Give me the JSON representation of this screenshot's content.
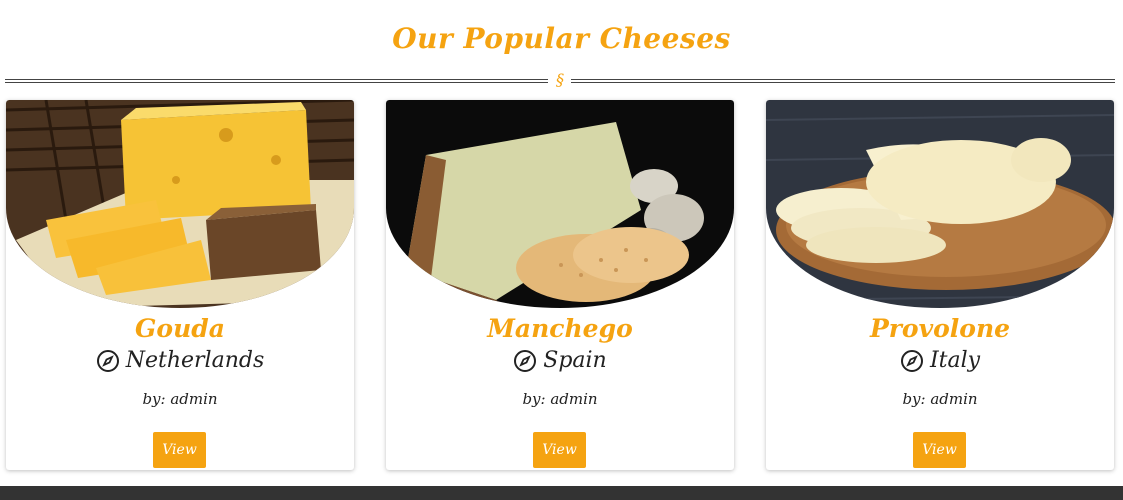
{
  "section": {
    "title": "Our Popular Cheeses",
    "divider_mark": "§"
  },
  "colors": {
    "accent": "#f5a311",
    "text": "#222222",
    "footer": "#333333"
  },
  "cards": [
    {
      "name": "Gouda",
      "origin": "Netherlands",
      "author": "by: admin",
      "button": "View",
      "origin_icon": "compass-icon"
    },
    {
      "name": "Manchego",
      "origin": "Spain",
      "author": "by: admin",
      "button": "View",
      "origin_icon": "compass-icon"
    },
    {
      "name": "Provolone",
      "origin": "Italy",
      "author": "by: admin",
      "button": "View",
      "origin_icon": "compass-icon"
    }
  ]
}
